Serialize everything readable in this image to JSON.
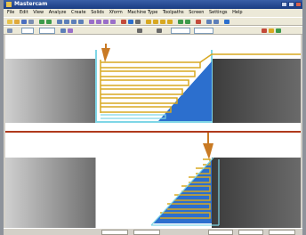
{
  "window": {
    "title": "Mastercam",
    "colors": {
      "title_bar": "#1a3c82",
      "background": "#d4d0c8"
    }
  },
  "menu": {
    "items": [
      "File",
      "Edit",
      "View",
      "Analyze",
      "Create",
      "Solids",
      "Xform",
      "Machine Type",
      "Toolpaths",
      "Screen",
      "Settings",
      "Help"
    ]
  },
  "toolbar2": {
    "field_a": "",
    "field_b": "",
    "field_c": "",
    "field_d": ""
  },
  "status": {
    "prompt": ""
  },
  "viewports": {
    "colors": {
      "stock_gray": "#6e6e6e",
      "stock_dark": "#3c3c3c",
      "toolpath": "#d8a821",
      "toolpath_outline": "#7fd6e6",
      "solid_blue": "#2c6fce",
      "divider": "#b03a1c",
      "tool_orange": "#c97a24"
    }
  }
}
